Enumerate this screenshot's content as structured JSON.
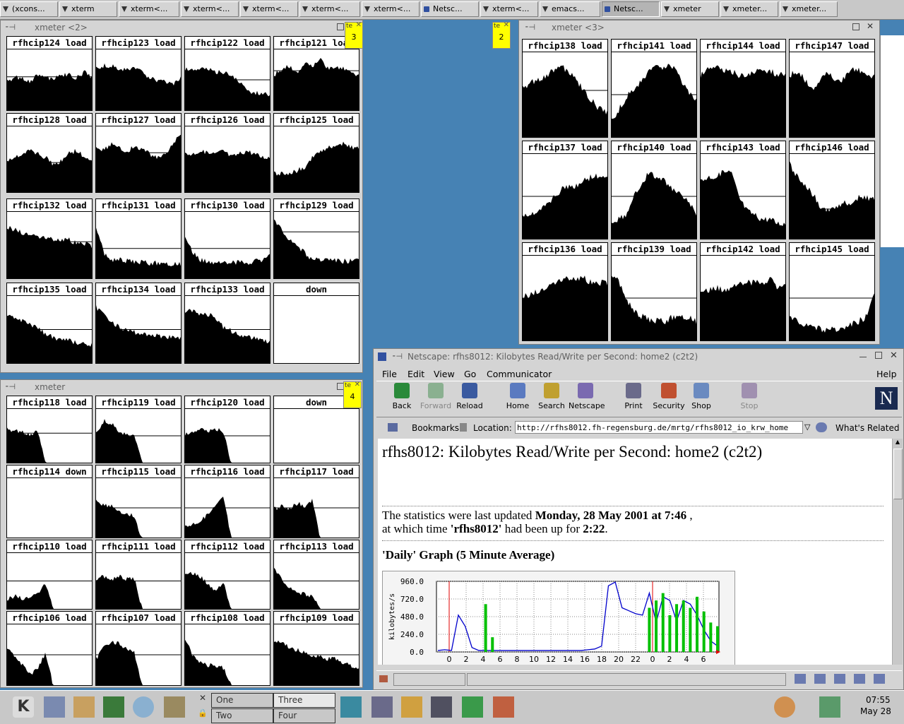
{
  "taskbar": {
    "items": [
      {
        "label": "(xcons...",
        "icon": "x-icon",
        "active": false
      },
      {
        "label": "xterm",
        "icon": "x-icon",
        "active": false
      },
      {
        "label": "xterm<...",
        "icon": "x-icon",
        "active": false
      },
      {
        "label": "xterm<...",
        "icon": "x-icon",
        "active": false
      },
      {
        "label": "xterm<...",
        "icon": "x-icon",
        "active": false
      },
      {
        "label": "xterm<...",
        "icon": "x-icon",
        "active": false
      },
      {
        "label": "xterm<...",
        "icon": "x-icon",
        "active": false
      },
      {
        "label": "Netsc...",
        "icon": "netscape-icon",
        "active": false
      },
      {
        "label": "xterm<...",
        "icon": "x-icon",
        "active": false
      },
      {
        "label": "emacs...",
        "icon": "x-icon",
        "active": false
      },
      {
        "label": "Netsc...",
        "icon": "netscape-icon",
        "active": true
      },
      {
        "label": "xmeter",
        "icon": "x-icon",
        "active": false
      },
      {
        "label": "xmeter...",
        "icon": "x-icon",
        "active": false
      },
      {
        "label": "xmeter...",
        "icon": "x-icon",
        "active": false
      }
    ]
  },
  "windows": {
    "xmeter2": {
      "title": "xmeter <2>",
      "note": {
        "tag": "te",
        "number": "3"
      },
      "graphs": [
        {
          "label": "rfhcip124 load",
          "ref": 0.45,
          "profile": [
            0.5,
            0.55,
            0.55,
            0.5,
            0.6,
            0.55,
            0.55,
            0.6,
            0.6,
            0.55,
            0.65,
            0.55
          ]
        },
        {
          "label": "rfhcip123 load",
          "ref": 0.6,
          "profile": [
            0.7,
            0.75,
            0.75,
            0.7,
            0.7,
            0.7,
            0.65,
            0.55,
            0.5,
            0.5,
            0.45,
            0.55
          ]
        },
        {
          "label": "rfhcip122 load",
          "ref": 0.5,
          "profile": [
            0.7,
            0.7,
            0.7,
            0.7,
            0.65,
            0.65,
            0.6,
            0.5,
            0.35,
            0.3,
            0.3,
            0.25
          ]
        },
        {
          "label": "rfhcip121 load",
          "ref": 0.35,
          "profile": [
            0.6,
            0.7,
            0.75,
            0.65,
            0.8,
            0.75,
            0.85,
            0.7,
            0.75,
            0.7,
            0.65,
            0.6
          ]
        },
        {
          "label": "rfhcip128 load",
          "ref": 0.55,
          "profile": [
            0.5,
            0.55,
            0.6,
            0.65,
            0.6,
            0.55,
            0.45,
            0.5,
            0.6,
            0.65,
            0.55,
            0.5
          ]
        },
        {
          "label": "rfhcip127 load",
          "ref": 0.4,
          "profile": [
            0.7,
            0.65,
            0.75,
            0.7,
            0.65,
            0.7,
            0.7,
            0.6,
            0.55,
            0.6,
            0.75,
            0.9
          ]
        },
        {
          "label": "rfhcip126 load",
          "ref": 0.5,
          "profile": [
            0.6,
            0.6,
            0.65,
            0.6,
            0.6,
            0.65,
            0.55,
            0.6,
            0.65,
            0.6,
            0.55,
            0.55
          ]
        },
        {
          "label": "rfhcip125 load",
          "ref": 0.75,
          "profile": [
            0.3,
            0.3,
            0.3,
            0.35,
            0.4,
            0.55,
            0.65,
            0.7,
            0.75,
            0.75,
            0.7,
            0.7
          ]
        },
        {
          "label": "rfhcip132 load",
          "ref": 0.45,
          "profile": [
            0.8,
            0.75,
            0.7,
            0.7,
            0.65,
            0.65,
            0.6,
            0.6,
            0.6,
            0.55,
            0.55,
            0.5
          ]
        },
        {
          "label": "rfhcip131 load",
          "ref": 0.55,
          "profile": [
            0.8,
            0.4,
            0.3,
            0.3,
            0.28,
            0.26,
            0.26,
            0.25,
            0.25,
            0.24,
            0.24,
            0.24
          ]
        },
        {
          "label": "rfhcip130 load",
          "ref": 0.55,
          "profile": [
            0.65,
            0.4,
            0.3,
            0.26,
            0.26,
            0.27,
            0.25,
            0.26,
            0.25,
            0.28,
            0.3,
            0.35
          ]
        },
        {
          "label": "rfhcip129 load",
          "ref": 0.3,
          "profile": [
            0.9,
            0.75,
            0.6,
            0.5,
            0.4,
            0.3,
            0.3,
            0.3,
            0.28,
            0.28,
            0.28,
            0.28
          ]
        },
        {
          "label": "rfhcip135 load",
          "ref": 0.5,
          "profile": [
            0.7,
            0.7,
            0.65,
            0.6,
            0.55,
            0.45,
            0.4,
            0.38,
            0.35,
            0.33,
            0.3,
            0.3
          ]
        },
        {
          "label": "rfhcip134 load",
          "ref": 0.5,
          "profile": [
            0.85,
            0.75,
            0.65,
            0.55,
            0.5,
            0.48,
            0.45,
            0.45,
            0.42,
            0.42,
            0.4,
            0.4
          ]
        },
        {
          "label": "rfhcip133 load",
          "ref": 0.5,
          "profile": [
            0.8,
            0.8,
            0.75,
            0.75,
            0.7,
            0.55,
            0.5,
            0.45,
            0.42,
            0.4,
            0.35,
            0.35
          ]
        },
        {
          "label": "down",
          "ref": null,
          "profile": []
        }
      ]
    },
    "xmeter3": {
      "title": "xmeter <3>",
      "note": {
        "tag": "te",
        "number": "2"
      },
      "graphs": [
        {
          "label": "rfhcip138 load",
          "ref": 0.45,
          "profile": [
            0.6,
            0.65,
            0.7,
            0.75,
            0.8,
            0.85,
            0.8,
            0.7,
            0.55,
            0.45,
            0.35,
            0.3
          ]
        },
        {
          "label": "rfhcip141 load",
          "ref": 0.5,
          "profile": [
            0.2,
            0.35,
            0.5,
            0.6,
            0.7,
            0.8,
            0.85,
            0.85,
            0.85,
            0.7,
            0.55,
            0.45
          ]
        },
        {
          "label": "rfhcip144 load",
          "ref": 0.5,
          "profile": [
            0.75,
            0.85,
            0.85,
            0.8,
            0.8,
            0.75,
            0.75,
            0.8,
            0.8,
            0.8,
            0.75,
            0.75
          ]
        },
        {
          "label": "rfhcip147 load",
          "ref": 0.55,
          "profile": [
            0.75,
            0.8,
            0.7,
            0.6,
            0.7,
            0.8,
            0.65,
            0.7,
            0.85,
            0.8,
            0.75,
            0.75
          ]
        },
        {
          "label": "rfhcip137 load",
          "ref": 0.5,
          "profile": [
            0.3,
            0.3,
            0.35,
            0.4,
            0.5,
            0.6,
            0.65,
            0.65,
            0.7,
            0.75,
            0.75,
            0.75
          ]
        },
        {
          "label": "rfhcip140 load",
          "ref": 0.5,
          "profile": [
            0.2,
            0.25,
            0.3,
            0.55,
            0.7,
            0.8,
            0.75,
            0.7,
            0.6,
            0.55,
            0.45,
            0.3
          ]
        },
        {
          "label": "rfhcip143 load",
          "ref": 0.5,
          "profile": [
            0.7,
            0.75,
            0.75,
            0.8,
            0.8,
            0.5,
            0.35,
            0.3,
            0.25,
            0.25,
            0.2,
            0.2
          ]
        },
        {
          "label": "rfhcip146 load",
          "ref": 0.65,
          "profile": [
            0.9,
            0.75,
            0.65,
            0.55,
            0.4,
            0.35,
            0.4,
            0.45,
            0.45,
            0.5,
            0.5,
            0.5
          ]
        },
        {
          "label": "rfhcip136 load",
          "ref": 0.5,
          "profile": [
            0.55,
            0.55,
            0.6,
            0.65,
            0.7,
            0.75,
            0.75,
            0.75,
            0.75,
            0.7,
            0.7,
            0.7
          ]
        },
        {
          "label": "rfhcip139 load",
          "ref": 0.5,
          "profile": [
            0.8,
            0.7,
            0.5,
            0.35,
            0.3,
            0.25,
            0.25,
            0.25,
            0.3,
            0.3,
            0.3,
            0.25
          ]
        },
        {
          "label": "rfhcip142 load",
          "ref": 0.5,
          "profile": [
            0.6,
            0.6,
            0.65,
            0.6,
            0.65,
            0.7,
            0.7,
            0.7,
            0.7,
            0.75,
            0.65,
            0.65
          ]
        },
        {
          "label": "rfhcip145 load",
          "ref": 0.5,
          "profile": [
            0.3,
            0.25,
            0.2,
            0.18,
            0.15,
            0.15,
            0.15,
            0.15,
            0.2,
            0.25,
            0.3,
            0.55
          ]
        }
      ]
    },
    "xmeter1": {
      "title": "xmeter",
      "note": {
        "tag": "te",
        "number": "4"
      },
      "graphs": [
        {
          "label": "rfhcip118 load",
          "ref": 0.45,
          "profile": [
            0.65,
            0.6,
            0.6,
            0.55,
            0.6,
            0.0,
            0.0,
            0.0,
            0.0,
            0.0,
            0.0,
            0.0
          ]
        },
        {
          "label": "rfhcip119 load",
          "ref": 0.5,
          "profile": [
            0.55,
            0.8,
            0.75,
            0.6,
            0.55,
            0.5,
            0.0,
            0.0,
            0.0,
            0.0,
            0.0,
            0.0
          ]
        },
        {
          "label": "rfhcip120 load",
          "ref": 0.5,
          "profile": [
            0.55,
            0.6,
            0.65,
            0.6,
            0.65,
            0.6,
            0.0,
            0.0,
            0.0,
            0.0,
            0.0,
            0.0
          ]
        },
        {
          "label": "down",
          "ref": null,
          "profile": []
        },
        {
          "label": "rfhcip114 down",
          "ref": null,
          "profile": []
        },
        {
          "label": "rfhcip115 load",
          "ref": 0.5,
          "profile": [
            0.65,
            0.55,
            0.55,
            0.45,
            0.45,
            0.35,
            0.0,
            0.0,
            0.0,
            0.0,
            0.0,
            0.0
          ]
        },
        {
          "label": "rfhcip116 load",
          "ref": 0.5,
          "profile": [
            0.2,
            0.25,
            0.3,
            0.4,
            0.55,
            0.7,
            0.0,
            0.0,
            0.0,
            0.0,
            0.0,
            0.0
          ]
        },
        {
          "label": "rfhcip117 load",
          "ref": 0.5,
          "profile": [
            0.5,
            0.55,
            0.5,
            0.6,
            0.55,
            0.65,
            0.0,
            0.0,
            0.0,
            0.0,
            0.0,
            0.0
          ]
        },
        {
          "label": "rfhcip110 load",
          "ref": 0.5,
          "profile": [
            0.2,
            0.25,
            0.2,
            0.25,
            0.3,
            0.5,
            0.0,
            0.0,
            0.0,
            0.0,
            0.0,
            0.0
          ]
        },
        {
          "label": "rfhcip111 load",
          "ref": 0.5,
          "profile": [
            0.55,
            0.6,
            0.55,
            0.6,
            0.55,
            0.55,
            0.0,
            0.0,
            0.0,
            0.0,
            0.0,
            0.0
          ]
        },
        {
          "label": "rfhcip112 load",
          "ref": 0.5,
          "profile": [
            0.65,
            0.65,
            0.6,
            0.45,
            0.35,
            0.5,
            0.0,
            0.0,
            0.0,
            0.0,
            0.0,
            0.0
          ]
        },
        {
          "label": "rfhcip113 load",
          "ref": 0.5,
          "profile": [
            0.75,
            0.55,
            0.4,
            0.3,
            0.28,
            0.25,
            0.0,
            0.0,
            0.0,
            0.0,
            0.0,
            0.0
          ]
        },
        {
          "label": "rfhcip106 load",
          "ref": 0.5,
          "profile": [
            0.6,
            0.5,
            0.35,
            0.2,
            0.3,
            0.55,
            0.0,
            0.0,
            0.0,
            0.0,
            0.0,
            0.0
          ]
        },
        {
          "label": "rfhcip107 load",
          "ref": 0.5,
          "profile": [
            0.45,
            0.65,
            0.75,
            0.7,
            0.6,
            0.55,
            0.0,
            0.0,
            0.0,
            0.0,
            0.0,
            0.0
          ]
        },
        {
          "label": "rfhcip108 load",
          "ref": 0.5,
          "profile": [
            0.8,
            0.5,
            0.4,
            0.35,
            0.35,
            0.3,
            0.0,
            0.0,
            0.0,
            0.0,
            0.0,
            0.0
          ]
        },
        {
          "label": "rfhcip109 load",
          "ref": 0.5,
          "profile": [
            0.75,
            0.7,
            0.65,
            0.6,
            0.55,
            0.5,
            0.5,
            0.45,
            0.45,
            0.4,
            0.35,
            0.3
          ]
        }
      ]
    },
    "netscape": {
      "title": "Netscape: rfhs8012: Kilobytes Read/Write per Second: home2 (c2t2)",
      "menu": [
        "File",
        "Edit",
        "View",
        "Go",
        "Communicator"
      ],
      "help": "Help",
      "toolbar": [
        {
          "label": "Back",
          "icon": "back-icon",
          "disabled": false,
          "color": "#2a8a3a"
        },
        {
          "label": "Forward",
          "icon": "forward-icon",
          "disabled": true,
          "color": "#8ab090"
        },
        {
          "label": "Reload",
          "icon": "reload-icon",
          "disabled": false,
          "color": "#3a5aa0"
        },
        {
          "label": "Home",
          "icon": "home-icon",
          "disabled": false,
          "color": "#5a7ac0"
        },
        {
          "label": "Search",
          "icon": "search-icon",
          "disabled": false,
          "color": "#c0a030"
        },
        {
          "label": "Netscape",
          "icon": "netscape-icon",
          "disabled": false,
          "color": "#7a6ab0"
        },
        {
          "label": "Print",
          "icon": "print-icon",
          "disabled": false,
          "color": "#6a6a8a"
        },
        {
          "label": "Security",
          "icon": "lock-icon",
          "disabled": false,
          "color": "#c05030"
        },
        {
          "label": "Shop",
          "icon": "shop-icon",
          "disabled": false,
          "color": "#6a8ac0"
        },
        {
          "label": "Stop",
          "icon": "stop-icon",
          "disabled": true,
          "color": "#a090b0"
        }
      ],
      "bookmarks_label": "Bookmarks",
      "location_label": "Location:",
      "url": "http://rfhs8012.fh-regensburg.de/mrtg/rfhs8012_io_krw_home",
      "whats_related": "What's Related",
      "page": {
        "heading": "rfhs8012: Kilobytes Read/Write per Second: home2 (c2t2)",
        "updated_prefix": "The statistics were last updated ",
        "updated_date": "Monday, 28 May 2001 at 7:46",
        "updated_suffix": " ,",
        "uptime_prefix": "at which time ",
        "uptime_host": "'rfhs8012'",
        "uptime_mid": " had been up for ",
        "uptime_value": "2:22",
        "uptime_suffix": ".",
        "graph_heading": "'Daily' Graph (5 Minute Average)"
      }
    }
  },
  "chart_data": {
    "type": "line",
    "ylabel": "kilobytes/s",
    "yticks": [
      "960.0",
      "720.0",
      "480.0",
      "240.0",
      "0.0"
    ],
    "ylim": [
      0,
      960
    ],
    "xticks": [
      "0",
      "2",
      "4",
      "6",
      "8",
      "10",
      "12",
      "14",
      "16",
      "18",
      "20",
      "22",
      "0",
      "2",
      "4",
      "6"
    ],
    "series": [
      {
        "color": "#0000cc",
        "values": [
          20,
          30,
          20,
          500,
          350,
          60,
          20,
          20,
          20,
          20,
          20,
          20,
          20,
          20,
          20,
          20,
          20,
          20,
          20,
          20,
          20,
          20,
          30,
          40,
          80,
          900,
          950,
          600,
          560,
          520,
          500,
          800,
          400,
          750,
          700,
          420,
          700,
          650,
          500,
          300,
          150,
          80
        ]
      },
      {
        "color": "#00c000",
        "values": [
          0,
          0,
          0,
          0,
          0,
          0,
          0,
          650,
          200,
          0,
          0,
          0,
          0,
          0,
          0,
          0,
          0,
          0,
          0,
          0,
          0,
          0,
          0,
          0,
          0,
          0,
          0,
          0,
          0,
          0,
          0,
          600,
          700,
          800,
          500,
          650,
          700,
          600,
          750,
          550,
          400,
          350
        ]
      }
    ],
    "grid": true
  },
  "bottompanel": {
    "desktops": [
      {
        "label": "One",
        "selected": false
      },
      {
        "label": "Three",
        "selected": true
      },
      {
        "label": "Two",
        "selected": false
      },
      {
        "label": "Four",
        "selected": false
      }
    ],
    "clock_time": "07:55",
    "clock_date": "May 28"
  }
}
